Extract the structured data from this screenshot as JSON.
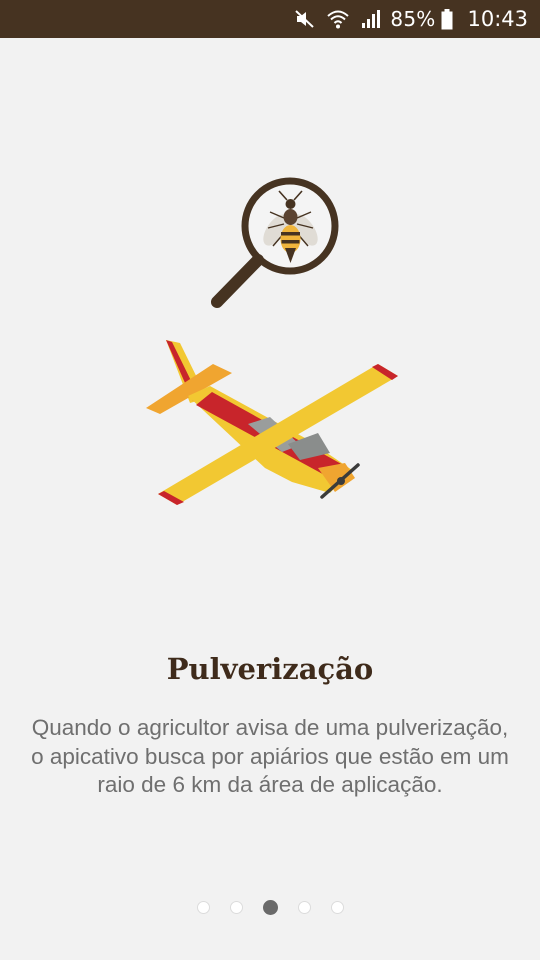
{
  "status_bar": {
    "icons": [
      "mute-icon",
      "wifi-icon",
      "signal-icon",
      "battery-icon"
    ],
    "battery": "85%",
    "time": "10:43",
    "background": "#463321"
  },
  "illustration": {
    "icons": [
      "magnifier-bee-icon",
      "crop-duster-airplane-icon"
    ]
  },
  "content": {
    "title": "Pulverização",
    "description": "Quando o agricultor avisa de uma pulverização, o apicativo busca por apiários que estão em um raio de 6 km da área de aplicação."
  },
  "pager": {
    "total": 5,
    "active_index": 2
  },
  "colors": {
    "background": "#f2f2f2",
    "title": "#3f2b1b",
    "text": "#6f6f6f",
    "plane_yellow": "#f2c832",
    "plane_red": "#c8252b",
    "plane_orange": "#f0a530"
  }
}
